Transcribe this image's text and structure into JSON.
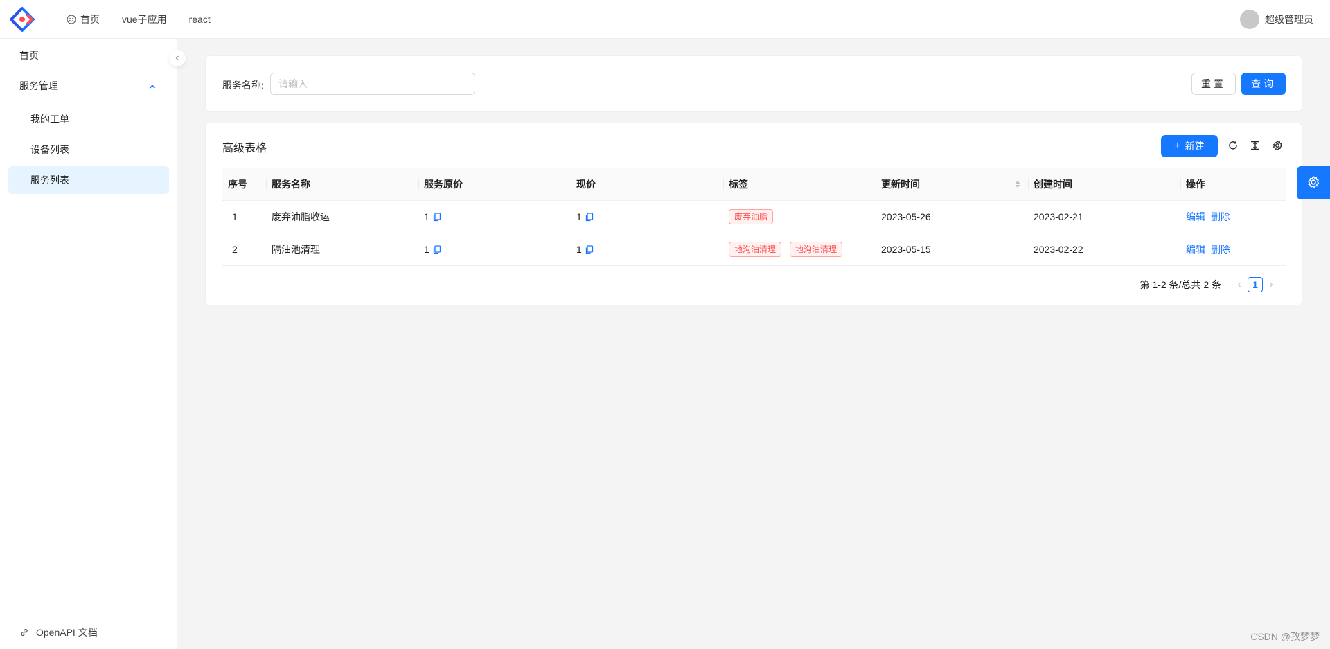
{
  "header": {
    "nav": [
      {
        "label": "首页",
        "icon": "smile-icon"
      },
      {
        "label": "vue子应用"
      },
      {
        "label": "react"
      }
    ],
    "user": {
      "name": "超级管理员"
    }
  },
  "sidebar": {
    "items": [
      {
        "label": "首页"
      },
      {
        "label": "服务管理"
      },
      {
        "label": "我的工单"
      },
      {
        "label": "设备列表"
      },
      {
        "label": "服务列表"
      }
    ],
    "footer": "OpenAPI 文档"
  },
  "search": {
    "label": "服务名称:",
    "placeholder": "请输入",
    "reset_label": "重置",
    "query_label": "查询"
  },
  "table": {
    "title": "高级表格",
    "new_label": "新建",
    "columns": [
      "序号",
      "服务名称",
      "服务原价",
      "现价",
      "标签",
      "更新时间",
      "创建时间",
      "操作"
    ],
    "rows": [
      {
        "idx": "1",
        "name": "废弃油脂收运",
        "price": "1",
        "current": "1",
        "tags": [
          "废弃油脂"
        ],
        "updated": "2023-05-26",
        "created": "2023-02-21",
        "edit": "编辑",
        "delete": "删除"
      },
      {
        "idx": "2",
        "name": "隔油池清理",
        "price": "1",
        "current": "1",
        "tags": [
          "地沟油清理",
          "地沟油清理"
        ],
        "updated": "2023-05-15",
        "created": "2023-02-22",
        "edit": "编辑",
        "delete": "删除"
      }
    ],
    "pagination": {
      "total_text": "第 1-2 条/总共 2 条",
      "current_page": "1"
    }
  },
  "watermark": "CSDN @孜梦梦",
  "colors": {
    "primary": "#1677ff",
    "tag_red": "#ff4d4f",
    "active_bg": "#e6f4ff"
  }
}
